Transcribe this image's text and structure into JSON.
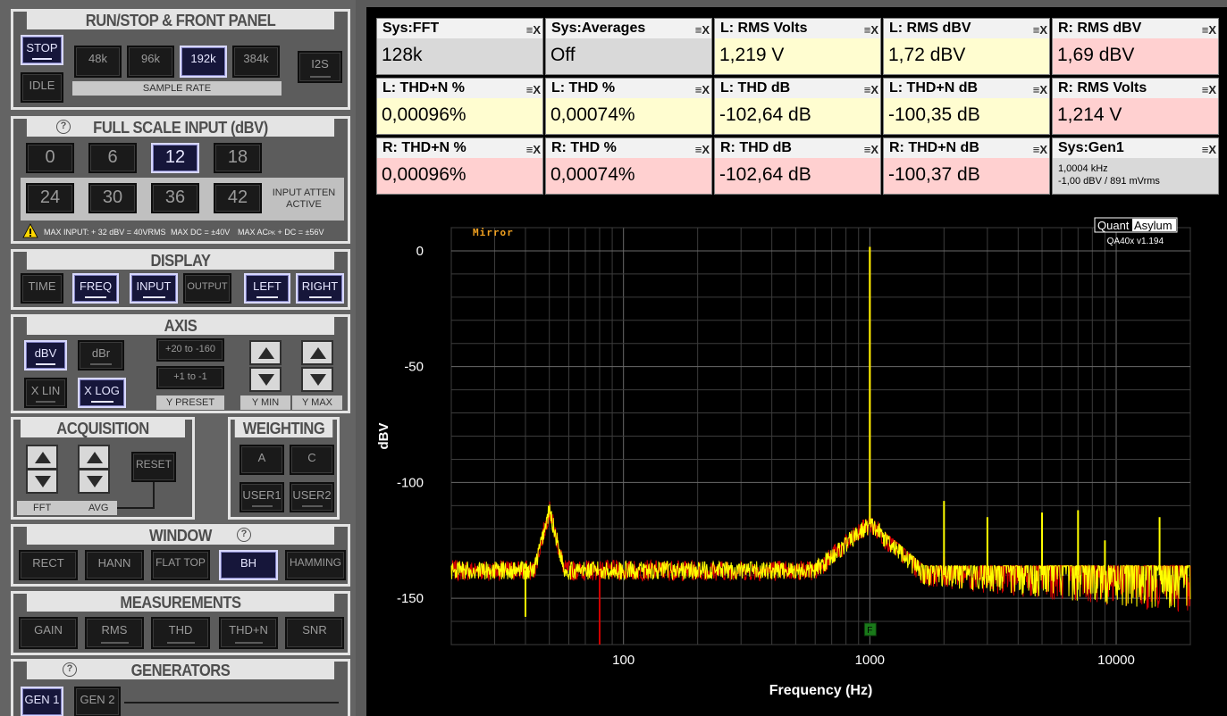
{
  "panels": {
    "run_stop": {
      "title": "RUN/STOP & FRONT PANEL",
      "stop_label": "STOP",
      "idle_label": "IDLE",
      "rates": [
        "48k",
        "96k",
        "192k",
        "384k"
      ],
      "sample_rate_label": "SAMPLE RATE",
      "i2s_label": "I2S",
      "selected_rate": "192k"
    },
    "full_scale": {
      "title": "FULL SCALE INPUT (dBV)",
      "help": "?",
      "levels": [
        "0",
        "6",
        "12",
        "18",
        "24",
        "30",
        "36",
        "42"
      ],
      "selected": "12",
      "atten_label_1": "INPUT ATTEN",
      "atten_label_2": "ACTIVE",
      "warning_1": "MAX INPUT: + 32 dBV = 40VRMS",
      "warning_2": "MAX DC = ±40V",
      "warning_3a": "MAX AC",
      "warning_3sub": "PK",
      "warning_3b": " + DC = ±56V"
    },
    "display": {
      "title": "DISPLAY",
      "buttons": [
        "TIME",
        "FREQ",
        "INPUT",
        "OUTPUT",
        "LEFT",
        "RIGHT"
      ],
      "active": [
        "FREQ",
        "INPUT",
        "LEFT",
        "RIGHT"
      ]
    },
    "axis": {
      "title": "AXIS",
      "dbv": "dBV",
      "dbr": "dBr",
      "xlin": "X LIN",
      "xlog": "X LOG",
      "preset1": "+20 to -160",
      "preset2": "+1 to -1",
      "y_preset": "Y PRESET",
      "y_min": "Y MIN",
      "y_max": "Y MAX"
    },
    "acquisition": {
      "title": "ACQUISITION",
      "reset": "RESET",
      "fft": "FFT",
      "avg": "AVG"
    },
    "weighting": {
      "title": "WEIGHTING",
      "a": "A",
      "c": "C",
      "user1": "USER1",
      "user2": "USER2"
    },
    "window": {
      "title": "WINDOW",
      "help": "?",
      "buttons": [
        "RECT",
        "HANN",
        "FLAT TOP",
        "BH",
        "HAMMING"
      ],
      "selected": "BH"
    },
    "measurements": {
      "title": "MEASUREMENTS",
      "buttons": [
        "GAIN",
        "RMS",
        "THD",
        "THD+N",
        "SNR"
      ]
    },
    "generators": {
      "title": "GENERATORS",
      "help": "?",
      "gen1": "GEN 1",
      "gen2": "GEN 2"
    }
  },
  "meters": [
    {
      "title": "Sys:FFT",
      "value": "128k",
      "color": "#d9d9d9"
    },
    {
      "title": "Sys:Averages",
      "value": "Off",
      "color": "#d9d9d9"
    },
    {
      "title": "L: RMS Volts",
      "value": "1,219 V",
      "color": "#fffdd0"
    },
    {
      "title": "L: RMS dBV",
      "value": "1,72 dBV",
      "color": "#fffdd0"
    },
    {
      "title": "R: RMS dBV",
      "value": "1,69 dBV",
      "color": "#ffd0d0"
    },
    {
      "title": "L: THD+N %",
      "value": "0,00096%",
      "color": "#fffdd0"
    },
    {
      "title": "L: THD %",
      "value": "0,00074%",
      "color": "#fffdd0"
    },
    {
      "title": "L: THD dB",
      "value": "-102,64 dB",
      "color": "#fffdd0"
    },
    {
      "title": "L: THD+N dB",
      "value": "-100,35 dB",
      "color": "#fffdd0"
    },
    {
      "title": "R: RMS Volts",
      "value": "1,214 V",
      "color": "#ffd0d0"
    },
    {
      "title": "R: THD+N %",
      "value": "0,00096%",
      "color": "#ffd0d0"
    },
    {
      "title": "R: THD %",
      "value": "0,00074%",
      "color": "#ffd0d0"
    },
    {
      "title": "R: THD dB",
      "value": "-102,64 dB",
      "color": "#ffd0d0"
    },
    {
      "title": "R: THD+N dB",
      "value": "-100,37 dB",
      "color": "#ffd0d0"
    },
    {
      "title": "Sys:Gen1",
      "value": "",
      "line1": "1,0004 kHz",
      "line2": "-1,00 dBV  / 891 mVrms",
      "color": "#d9d9d9"
    }
  ],
  "meter_icons": {
    "menu": "≡",
    "close": "X"
  },
  "chart_data": {
    "type": "line",
    "xlabel": "Frequency (Hz)",
    "ylabel": "dBV",
    "xscale": "log",
    "xlim": [
      20,
      20000
    ],
    "ylim": [
      -170,
      10
    ],
    "x_ticks": [
      "100",
      "1000",
      "10000"
    ],
    "y_ticks": [
      "0",
      "-50",
      "-100",
      "-150"
    ],
    "mirror_label": "Mirror",
    "brand_left": "Quant",
    "brand_right": "Asylum",
    "version": "QA40x v1.194",
    "marker_label": "F",
    "series": [
      {
        "color": "#d00000",
        "noise_floor": -138,
        "fundamental": {
          "x": 1000,
          "y": 1.7
        },
        "harmonics": [
          {
            "x": 2000,
            "y": -132
          },
          {
            "x": 3000,
            "y": -138
          },
          {
            "x": 5000,
            "y": -135
          },
          {
            "x": 7000,
            "y": -138
          }
        ]
      },
      {
        "color": "#ffff00",
        "noise_floor": -138,
        "fundamental": {
          "x": 1000,
          "y": 1.7
        },
        "harmonics": [
          {
            "x": 2000,
            "y": -108
          },
          {
            "x": 3000,
            "y": -115
          },
          {
            "x": 5000,
            "y": -113
          },
          {
            "x": 7000,
            "y": -112
          },
          {
            "x": 9000,
            "y": -125
          },
          {
            "x": 15000,
            "y": -115
          }
        ]
      }
    ],
    "features": [
      {
        "x": 50,
        "y": -111
      },
      {
        "x": 1000,
        "y": -117
      },
      {
        "x": 40,
        "y": -158
      },
      {
        "x": 80,
        "y": -170
      }
    ]
  }
}
